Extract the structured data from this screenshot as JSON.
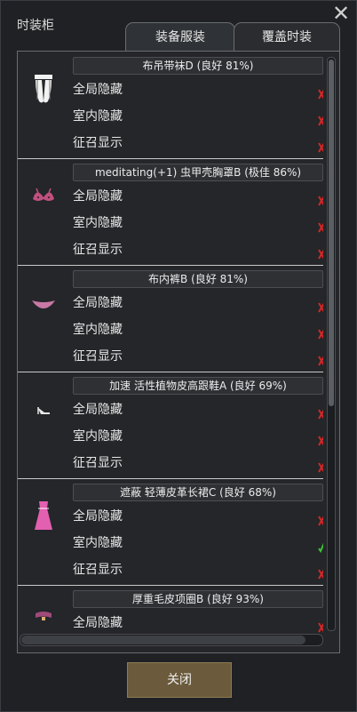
{
  "window": {
    "title": "时装柜",
    "close_glyph": "✕"
  },
  "tabs": [
    {
      "label": "装备服装",
      "active": true
    },
    {
      "label": "覆盖时装",
      "active": false
    }
  ],
  "groups": [
    {
      "name": "布吊带袜D (良好 81%)",
      "icon": "garter-stockings-icon",
      "icon_color": "#f2f2f2",
      "rows": [
        {
          "label": "全局隐藏",
          "checked": false
        },
        {
          "label": "室内隐藏",
          "checked": false
        },
        {
          "label": "征召显示",
          "checked": false
        }
      ]
    },
    {
      "name": "meditating(+1) 虫甲壳胸罩B (极佳 86%)",
      "icon": "bra-icon",
      "icon_color": "#c0507f",
      "rows": [
        {
          "label": "全局隐藏",
          "checked": false
        },
        {
          "label": "室内隐藏",
          "checked": false
        },
        {
          "label": "征召显示",
          "checked": false
        }
      ]
    },
    {
      "name": "布内裤B (良好 81%)",
      "icon": "panties-icon",
      "icon_color": "#c978a5",
      "rows": [
        {
          "label": "全局隐藏",
          "checked": false
        },
        {
          "label": "室内隐藏",
          "checked": false
        },
        {
          "label": "征召显示",
          "checked": false
        }
      ]
    },
    {
      "name": "加速 活性植物皮高跟鞋A (良好 69%)",
      "icon": "high-heels-icon",
      "icon_color": "#e6e6e6",
      "rows": [
        {
          "label": "全局隐藏",
          "checked": false
        },
        {
          "label": "室内隐藏",
          "checked": false
        },
        {
          "label": "征召显示",
          "checked": false
        }
      ]
    },
    {
      "name": "遮蔽 轻薄皮革长裙C (良好 68%)",
      "icon": "dress-icon",
      "icon_color": "#e35fb0",
      "rows": [
        {
          "label": "全局隐藏",
          "checked": false
        },
        {
          "label": "室内隐藏",
          "checked": true
        },
        {
          "label": "征召显示",
          "checked": false
        }
      ]
    },
    {
      "name": "厚重毛皮项圈B (良好 93%)",
      "icon": "collar-icon",
      "icon_color": "#a04a7a",
      "rows": [
        {
          "label": "全局隐藏",
          "checked": false
        }
      ]
    }
  ],
  "colors": {
    "unchecked": "#d62828",
    "checked": "#3fc13a"
  },
  "scroll": {
    "vertical_position": 0.0,
    "horizontal_position": 0.0
  },
  "footer": {
    "close_label": "关闭"
  }
}
